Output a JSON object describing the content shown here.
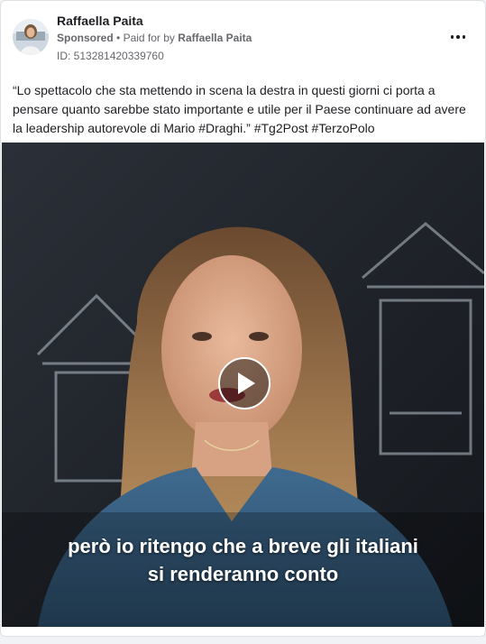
{
  "ad": {
    "page_name": "Raffaella Paita",
    "sponsored_label": "Sponsored",
    "separator": "•",
    "paid_for_prefix": "Paid for by",
    "paid_for_name": "Raffaella Paita",
    "ad_id": "ID: 513281420339760",
    "more_icon": "more-options-icon",
    "body_text": "“Lo spettacolo che sta mettendo in scena la destra in questi giorni ci porta a pensare quanto sarebbe stato importante e utile per il Paese continuare ad avere la leadership autorevole di Mario #Draghi.” #Tg2Post #TerzoPolo"
  },
  "video": {
    "caption_line1": "però io ritengo che a breve gli italiani",
    "caption_line2": "si renderanno conto",
    "play_icon": "play-icon"
  },
  "colors": {
    "card_bg": "#ffffff",
    "secondary_text": "#65676b",
    "primary_text": "#1c1e21",
    "video_bg": "#1a1d22"
  }
}
